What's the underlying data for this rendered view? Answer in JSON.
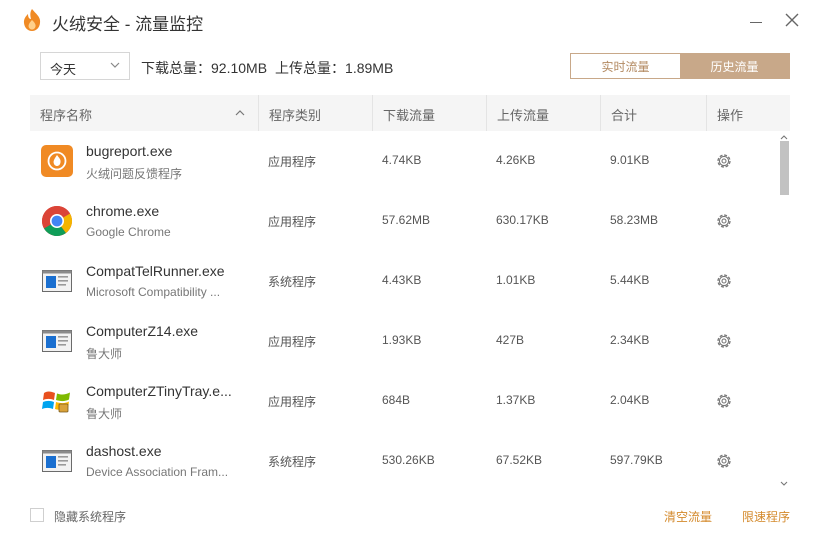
{
  "window": {
    "title": "火绒安全 - 流量监控"
  },
  "toolbar": {
    "range_selected": "今天",
    "download_total_label": "下载总量：",
    "download_total": "92.10MB",
    "upload_total_label": "上传总量：",
    "upload_total": "1.89MB",
    "tabs": [
      {
        "label": "实时流量",
        "active": false
      },
      {
        "label": "历史流量",
        "active": true
      }
    ]
  },
  "table": {
    "columns": [
      "程序名称",
      "程序类别",
      "下载流量",
      "上传流量",
      "合计",
      "操作"
    ],
    "rows": [
      {
        "name": "bugreport.exe",
        "desc": "火绒问题反馈程序",
        "category": "应用程序",
        "download": "4.74KB",
        "upload": "4.26KB",
        "total": "9.01KB",
        "icon": "bugreport-icon"
      },
      {
        "name": "chrome.exe",
        "desc": "Google Chrome",
        "category": "应用程序",
        "download": "57.62MB",
        "upload": "630.17KB",
        "total": "58.23MB",
        "icon": "chrome-icon"
      },
      {
        "name": "CompatTelRunner.exe",
        "desc": "Microsoft Compatibility ...",
        "category": "系统程序",
        "download": "4.43KB",
        "upload": "1.01KB",
        "total": "5.44KB",
        "icon": "window-app-icon"
      },
      {
        "name": "ComputerZ14.exe",
        "desc": "鲁大师",
        "category": "应用程序",
        "download": "1.93KB",
        "upload": "427B",
        "total": "2.34KB",
        "icon": "window-app-icon"
      },
      {
        "name": "ComputerZTinyTray.e...",
        "desc": "鲁大师",
        "category": "应用程序",
        "download": "684B",
        "upload": "1.37KB",
        "total": "2.04KB",
        "icon": "windows-flag-icon"
      },
      {
        "name": "dashost.exe",
        "desc": "Device Association Fram...",
        "category": "系统程序",
        "download": "530.26KB",
        "upload": "67.52KB",
        "total": "597.79KB",
        "icon": "window-app-icon"
      }
    ]
  },
  "footer": {
    "hide_system_label": "隐藏系统程序",
    "clear_label": "清空流量",
    "limit_label": "限速程序"
  },
  "colors": {
    "accent": "#c8a889",
    "link": "#d48a2c",
    "logo": "#f08a24"
  }
}
